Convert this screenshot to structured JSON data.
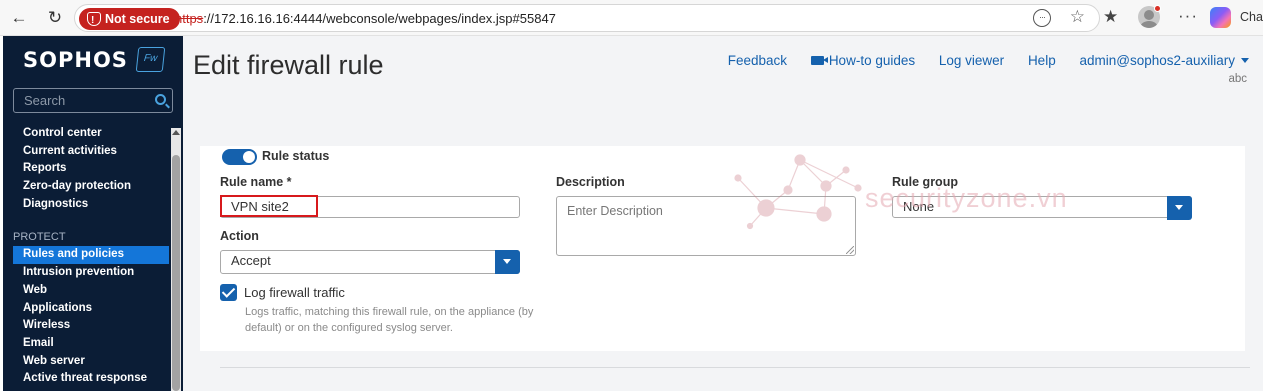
{
  "browser": {
    "security_label": "Not secure",
    "url_scheme": "https",
    "url_rest": "://172.16.16.16:4444/webconsole/webpages/index.jsp#55847",
    "copilot_label": "Chat"
  },
  "sidebar": {
    "brand": "SOPHOS",
    "badge": "Fw",
    "search_placeholder": "Search",
    "items_top": [
      "Control center",
      "Current activities",
      "Reports",
      "Zero-day protection",
      "Diagnostics"
    ],
    "section": "PROTECT",
    "items_protect": [
      "Rules and policies",
      "Intrusion prevention",
      "Web",
      "Applications",
      "Wireless",
      "Email",
      "Web server",
      "Active threat response"
    ],
    "active_item": "Rules and policies"
  },
  "header": {
    "title": "Edit firewall rule",
    "links": {
      "feedback": "Feedback",
      "howto": "How-to guides",
      "logviewer": "Log viewer",
      "help": "Help",
      "user": "admin@sophos2-auxiliary"
    },
    "subuser": "abc"
  },
  "form": {
    "status_label": "Rule status",
    "status_on": true,
    "rule_name_label": "Rule name *",
    "rule_name_value": "VPN site2",
    "description_label": "Description",
    "description_placeholder": "Enter Description",
    "rule_group_label": "Rule group",
    "rule_group_value": "None",
    "action_label": "Action",
    "action_value": "Accept",
    "log_label": "Log firewall traffic",
    "log_checked": true,
    "log_help": "Logs traffic, matching this firewall rule, on the appliance (by default) or on the configured syslog server."
  },
  "watermark": {
    "text": "securityzone.vn"
  },
  "colors": {
    "sidebar_bg": "#0b1d36",
    "accent": "#1561ad",
    "active_item": "#1476d9",
    "highlight": "#d7191c"
  }
}
